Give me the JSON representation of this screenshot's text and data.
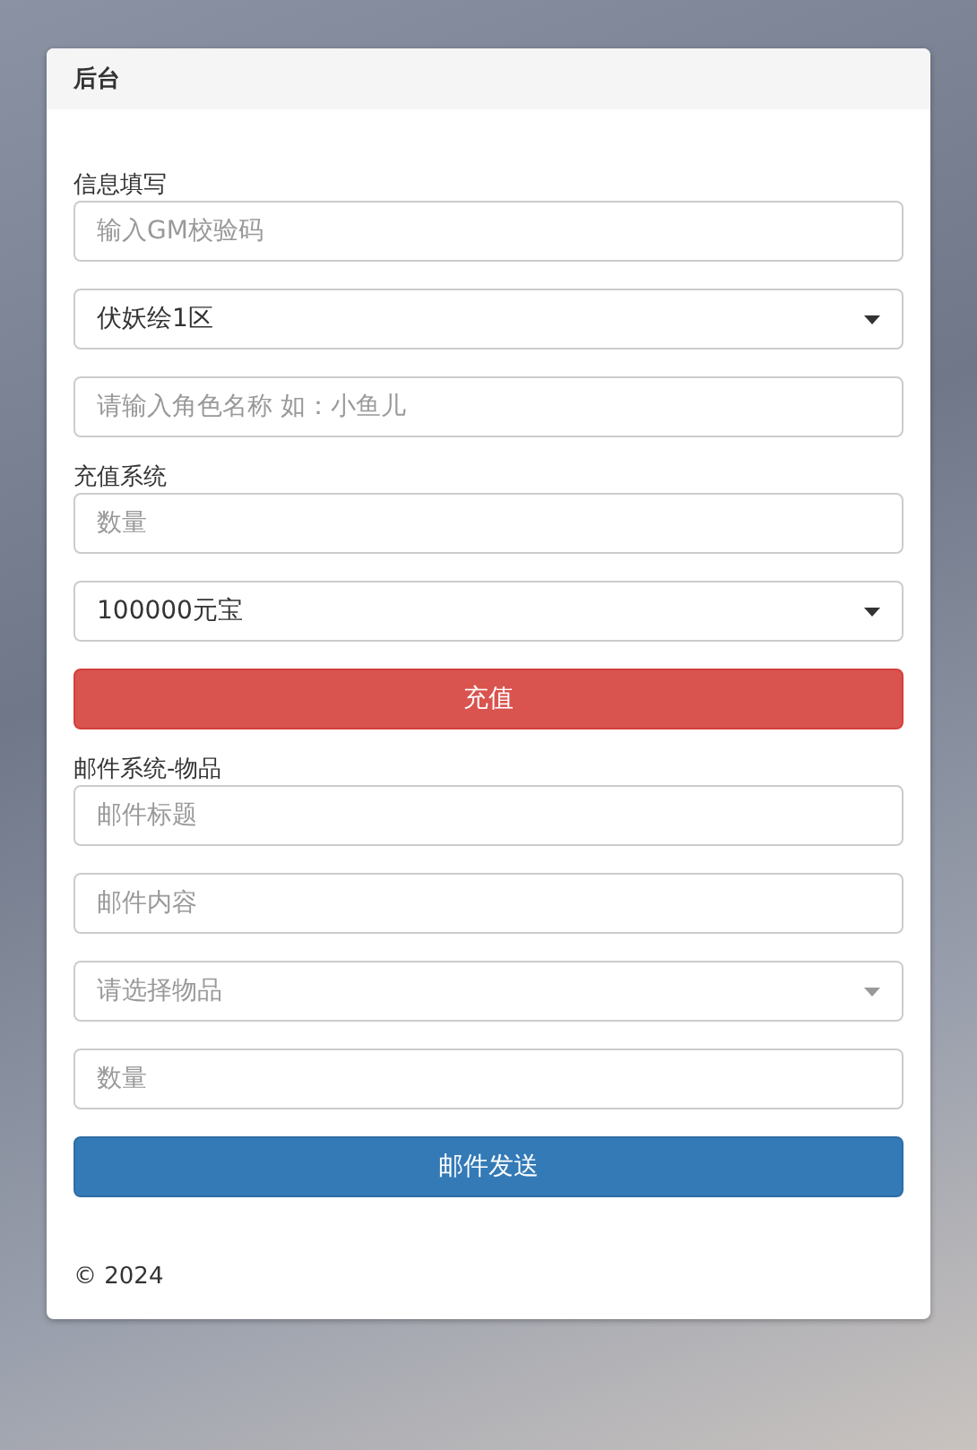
{
  "header": {
    "title": "后台"
  },
  "sections": [
    {
      "label": "信息填写",
      "fields": [
        {
          "kind": "input",
          "placeholder": "输入GM校验码"
        },
        {
          "kind": "select",
          "value": "伏妖绘1区"
        },
        {
          "kind": "input",
          "placeholder": "请输入角色名称 如：小鱼儿"
        }
      ]
    },
    {
      "label": "充值系统",
      "fields": [
        {
          "kind": "input",
          "placeholder": "数量"
        },
        {
          "kind": "select",
          "value": "100000元宝"
        }
      ],
      "button": {
        "label": "充值",
        "kind": "danger"
      }
    },
    {
      "label": "邮件系统-物品",
      "fields": [
        {
          "kind": "input",
          "placeholder": "邮件标题"
        },
        {
          "kind": "input",
          "placeholder": "邮件内容"
        },
        {
          "kind": "select",
          "placeholder": "请选择物品"
        },
        {
          "kind": "input",
          "placeholder": "数量"
        }
      ],
      "button": {
        "label": "邮件发送",
        "kind": "primary"
      }
    }
  ],
  "footer": "© 2024"
}
